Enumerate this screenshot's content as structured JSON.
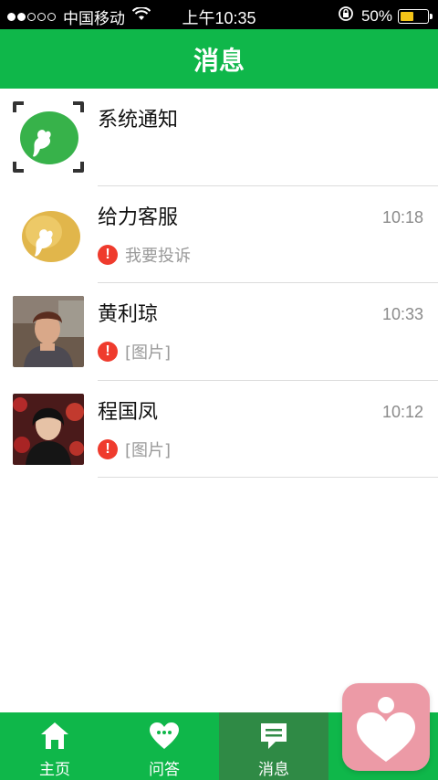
{
  "status_bar": {
    "carrier": "中国移动",
    "time": "上午10:35",
    "battery": "50%",
    "battery_level": 0.5
  },
  "header": {
    "title": "消息"
  },
  "conversations": [
    {
      "name": "系统通知",
      "time": "",
      "preview": "",
      "avatar_icon": "green-logo-icon"
    },
    {
      "name": "给力客服",
      "time": "10:18",
      "preview": "我要投诉",
      "avatar_icon": "gold-logo-icon"
    },
    {
      "name": "黄利琼",
      "time": "10:33",
      "preview": "[图片]",
      "avatar_icon": "user-photo"
    },
    {
      "name": "程国凤",
      "time": "10:12",
      "preview": "[图片]",
      "avatar_icon": "user-photo"
    }
  ],
  "tab_bar": {
    "tabs": [
      {
        "label": "主页",
        "icon": "home-icon"
      },
      {
        "label": "问答",
        "icon": "heart-chat-icon"
      },
      {
        "label": "消息",
        "icon": "message-icon",
        "active": true
      },
      {
        "label": "",
        "icon": "profile-icon"
      }
    ]
  },
  "colors": {
    "accent": "#0fb74a",
    "active_tab": "#2f8a45",
    "alert": "#ef3b2d",
    "float_button": "#ec9aa6"
  }
}
